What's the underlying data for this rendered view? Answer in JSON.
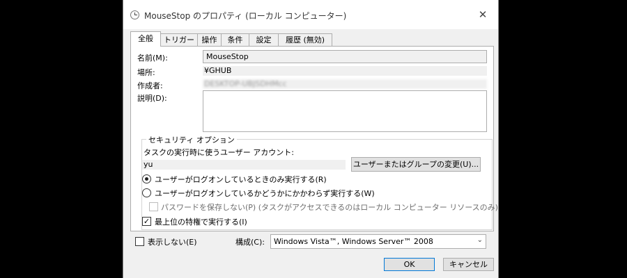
{
  "window": {
    "title": "MouseStop のプロパティ (ローカル コンピューター)",
    "close_glyph": "✕"
  },
  "tabs": [
    {
      "label": "全般"
    },
    {
      "label": "トリガー"
    },
    {
      "label": "操作"
    },
    {
      "label": "条件"
    },
    {
      "label": "設定"
    },
    {
      "label": "履歴 (無効)"
    }
  ],
  "general": {
    "name_label": "名前(M):",
    "name_value": "MouseStop",
    "location_label": "場所:",
    "location_value": "¥GHUB",
    "author_label": "作成者:",
    "author_value": "DESKTOP-UBJSDHMcc",
    "description_label": "説明(D):",
    "description_value": ""
  },
  "security": {
    "group_title": "セキュリティ オプション",
    "run_as_label": "タスクの実行時に使うユーザー アカウント:",
    "user_value": "yu",
    "change_user_button": "ユーザーまたはグループの変更(U)...",
    "radio_logged_on": "ユーザーがログオンしているときのみ実行する(R)",
    "radio_logged_on_selected": true,
    "radio_whether": "ユーザーがログオンしているかどうかにかかわらず実行する(W)",
    "radio_whether_selected": false,
    "no_store_password": "パスワードを保存しない(P) (タスクがアクセスできるのはローカル コンピューター リソースのみ)",
    "highest_privileges": "最上位の特権で実行する(I)",
    "highest_privileges_checked": true,
    "check_glyph": "✓"
  },
  "footer": {
    "hidden_label": "表示しない(E)",
    "configure_label": "構成(C):",
    "configure_value": "Windows Vista™, Windows Server™ 2008",
    "chevron_glyph": "⌄",
    "ok_button": "OK",
    "cancel_button": "キャンセル"
  }
}
